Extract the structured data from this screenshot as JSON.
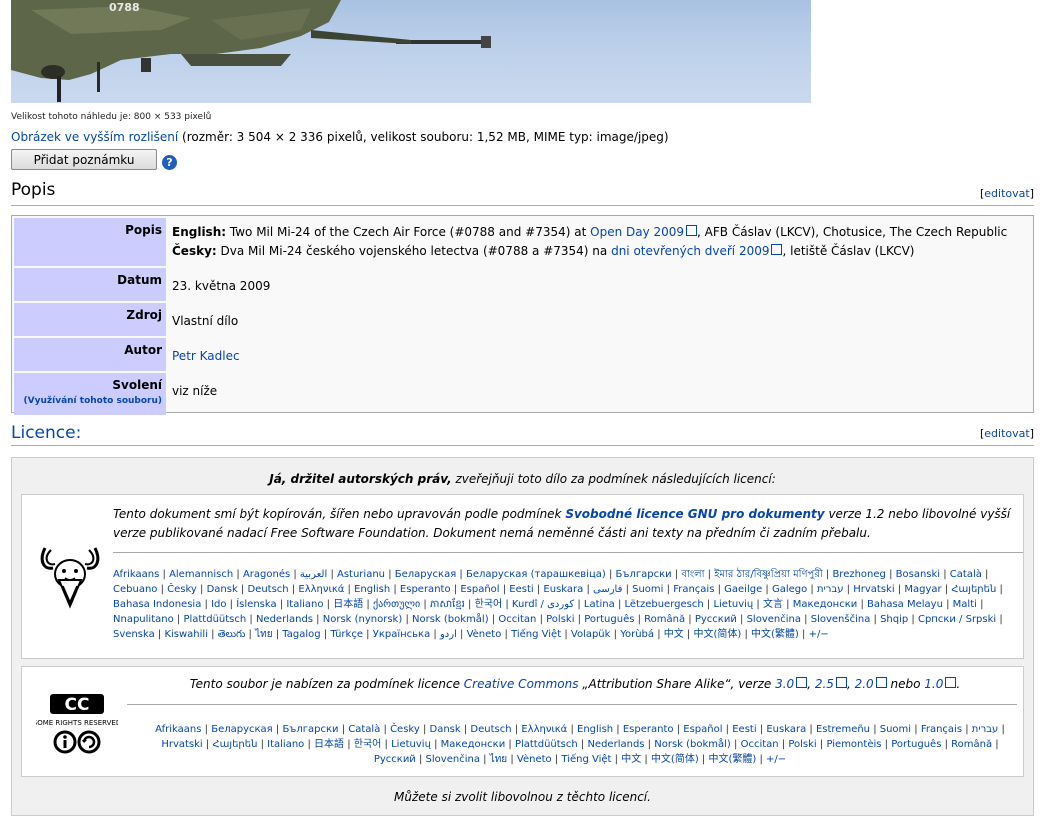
{
  "image": {
    "visible_text": "0788"
  },
  "preview_size_text": "Velikost tohoto náhledu je: 800 × 533 pixelů",
  "full_resolution": {
    "link": "Obrázek ve vyšším rozlišení",
    "details": "(rozměr: 3 504 × 2 336 pixelů, velikost souboru: 1,52 MB, MIME typ: image/jpeg)"
  },
  "add_note_button": "Přidat poznámku",
  "help_icon": "?",
  "popis": {
    "heading": "Popis",
    "edit_link": "editovat",
    "rows": {
      "popis": {
        "label": "Popis",
        "english_label": "English:",
        "english_text": "Two Mil Mi-24 of the Czech Air Force (#0788 and #7354) at",
        "english_link": "Open Day 2009",
        "english_rest": ", AFB Čáslav (LKCV), Chotusice, The Czech Republic",
        "czech_label": "Česky:",
        "czech_text": "Dva Mil Mi-24 českého vojenského letectva (#0788 a #7354) na",
        "czech_link": "dni otevřených dveří 2009",
        "czech_rest": ", letiště Čáslav (LKCV)"
      },
      "datum": {
        "label": "Datum",
        "value": "23. května 2009"
      },
      "zdroj": {
        "label": "Zdroj",
        "value": "Vlastní dílo"
      },
      "autor": {
        "label": "Autor",
        "value": "Petr Kadlec"
      },
      "svoleni": {
        "label": "Svolení",
        "sub_link": "(Využívání tohoto souboru)",
        "value": "viz níže"
      }
    }
  },
  "licence": {
    "heading": "Licence:",
    "edit_link": "editovat",
    "intro_bold": "Já, držitel autorských práv,",
    "intro_rest": " zveřejňuji toto dílo za podmínek následujících licencí:",
    "gfdl": {
      "text_1": "Tento dokument smí být kopírován, šířen nebo upravován podle podmínek ",
      "link": "Svobodné licence GNU pro dokumenty",
      "text_2": " verze 1.2 nebo libovolné vyšší verze publikované nadací Free Software Foundation. Dokument nemá neměnné části ani texty na předním či zadním přebalu.",
      "languages": [
        "Afrikaans",
        "Alemannisch",
        "Aragonés",
        "العربية",
        "Asturianu",
        "Беларуская",
        "Беларуская (тарашкевіца)",
        "Български",
        "বাংলা",
        "ইমার ঠার/বিষ্ণুপ্রিয়া মণিপুরী",
        "Brezhoneg",
        "Bosanski",
        "Català",
        "Cebuano",
        "Česky",
        "Dansk",
        "Deutsch",
        "Ελληνικά",
        "English",
        "Esperanto",
        "Español",
        "Eesti",
        "Euskara",
        "فارسی",
        "Suomi",
        "Français",
        "Gaeilge",
        "Galego",
        "עברית",
        "Hrvatski",
        "Magyar",
        "Հայերեն",
        "Bahasa Indonesia",
        "Ido",
        "Íslenska",
        "Italiano",
        "日本語",
        "ქართული",
        "ភាសាខ្មែរ",
        "한국어",
        "Kurdî / كوردی",
        "Latina",
        "Lëtzebuergesch",
        "Lietuvių",
        "文言",
        "Македонски",
        "Bahasa Melayu",
        "Malti",
        "Nnapulitano",
        "Plattdüütsch",
        "Nederlands",
        "Norsk (nynorsk)",
        "Norsk (bokmål)",
        "Occitan",
        "Polski",
        "Português",
        "Română",
        "Русский",
        "Slovenčina",
        "Slovenščina",
        "Shqip",
        "Српски / Srpski",
        "Svenska",
        "Kiswahili",
        "తెలుగు",
        "ไทย",
        "Tagalog",
        "Türkçe",
        "Українська",
        "اردو",
        "Vèneto",
        "Tiếng Việt",
        "Volapük",
        "Yorùbá",
        "中文",
        "中文(简体)",
        "中文(繁體)",
        "+/−"
      ]
    },
    "cc": {
      "logo_cc": "CC",
      "logo_sub": "SOME RIGHTS RESERVED",
      "text_1": "Tento soubor je nabízen za podmínek licence ",
      "link": "Creative Commons",
      "text_2": " „Attribution Share Alike“, verze ",
      "versions": [
        "3.0",
        "2.5",
        "2.0",
        "1.0"
      ],
      "nebo": "nebo",
      "languages": [
        "Afrikaans",
        "Беларуская",
        "Български",
        "Català",
        "Česky",
        "Dansk",
        "Deutsch",
        "Ελληνικά",
        "English",
        "Esperanto",
        "Español",
        "Eesti",
        "Euskara",
        "Estremeñu",
        "Suomi",
        "Français",
        "עברית",
        "Hrvatski",
        "Հայերեն",
        "Italiano",
        "日本語",
        "한국어",
        "Lietuvių",
        "Македонски",
        "Plattdüütsch",
        "Nederlands",
        "Norsk (bokmål)",
        "Occitan",
        "Polski",
        "Piemontèis",
        "Português",
        "Română",
        "Русский",
        "Slovenčina",
        "ไทย",
        "Vèneto",
        "Tiếng Việt",
        "中文",
        "中文(简体)",
        "中文(繁體)",
        "+/−"
      ]
    },
    "footer": "Můžete si zvolit libovolnou z těchto licencí."
  },
  "colors": {
    "link": "#0645ad",
    "label_bg": "#ccccff",
    "box_bg": "#f0f0f0"
  }
}
